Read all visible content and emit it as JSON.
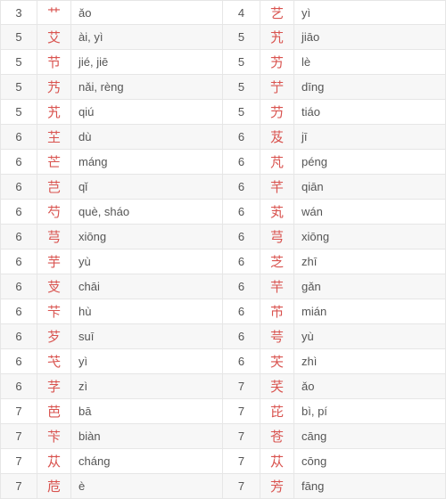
{
  "left": [
    {
      "strokes": "3",
      "char": "艹",
      "pinyin": "ǎo"
    },
    {
      "strokes": "5",
      "char": "艾",
      "pinyin": "ài, yì"
    },
    {
      "strokes": "5",
      "char": "节",
      "pinyin": "jié, jiē"
    },
    {
      "strokes": "5",
      "char": "艿",
      "pinyin": "nǎi, rèng"
    },
    {
      "strokes": "5",
      "char": "艽",
      "pinyin": "qiú"
    },
    {
      "strokes": "6",
      "char": "芏",
      "pinyin": "dù"
    },
    {
      "strokes": "6",
      "char": "芒",
      "pinyin": "máng"
    },
    {
      "strokes": "6",
      "char": "芑",
      "pinyin": "qǐ"
    },
    {
      "strokes": "6",
      "char": "芍",
      "pinyin": "què, sháo"
    },
    {
      "strokes": "6",
      "char": "芎",
      "pinyin": "xiōng"
    },
    {
      "strokes": "6",
      "char": "芋",
      "pinyin": "yù"
    },
    {
      "strokes": "6",
      "char": "芆",
      "pinyin": "chāi"
    },
    {
      "strokes": "6",
      "char": "芐",
      "pinyin": "hù"
    },
    {
      "strokes": "6",
      "char": "芕",
      "pinyin": "suī"
    },
    {
      "strokes": "6",
      "char": "芅",
      "pinyin": "yì"
    },
    {
      "strokes": "6",
      "char": "芓",
      "pinyin": "zì"
    },
    {
      "strokes": "7",
      "char": "芭",
      "pinyin": "bā"
    },
    {
      "strokes": "7",
      "char": "苄",
      "pinyin": "biàn"
    },
    {
      "strokes": "7",
      "char": "苁",
      "pinyin": "cháng"
    },
    {
      "strokes": "7",
      "char": "苊",
      "pinyin": "è"
    }
  ],
  "right": [
    {
      "strokes": "4",
      "char": "艺",
      "pinyin": "yì"
    },
    {
      "strokes": "5",
      "char": "艽",
      "pinyin": "jiāo"
    },
    {
      "strokes": "5",
      "char": "艻",
      "pinyin": "lè"
    },
    {
      "strokes": "5",
      "char": "艼",
      "pinyin": "dīng"
    },
    {
      "strokes": "5",
      "char": "芀",
      "pinyin": "tiáo"
    },
    {
      "strokes": "6",
      "char": "芨",
      "pinyin": "jī"
    },
    {
      "strokes": "6",
      "char": "芃",
      "pinyin": "péng"
    },
    {
      "strokes": "6",
      "char": "芊",
      "pinyin": "qiān"
    },
    {
      "strokes": "6",
      "char": "芄",
      "pinyin": "wán"
    },
    {
      "strokes": "6",
      "char": "芎",
      "pinyin": "xiōng"
    },
    {
      "strokes": "6",
      "char": "芝",
      "pinyin": "zhī"
    },
    {
      "strokes": "6",
      "char": "芉",
      "pinyin": "gǎn"
    },
    {
      "strokes": "6",
      "char": "芇",
      "pinyin": "mián"
    },
    {
      "strokes": "6",
      "char": "芌",
      "pinyin": "yù"
    },
    {
      "strokes": "6",
      "char": "芖",
      "pinyin": "zhì"
    },
    {
      "strokes": "7",
      "char": "芺",
      "pinyin": "ǎo"
    },
    {
      "strokes": "7",
      "char": "芘",
      "pinyin": "bì, pí"
    },
    {
      "strokes": "7",
      "char": "苍",
      "pinyin": "cāng"
    },
    {
      "strokes": "7",
      "char": "苁",
      "pinyin": "cōng"
    },
    {
      "strokes": "7",
      "char": "芳",
      "pinyin": "fāng"
    }
  ]
}
